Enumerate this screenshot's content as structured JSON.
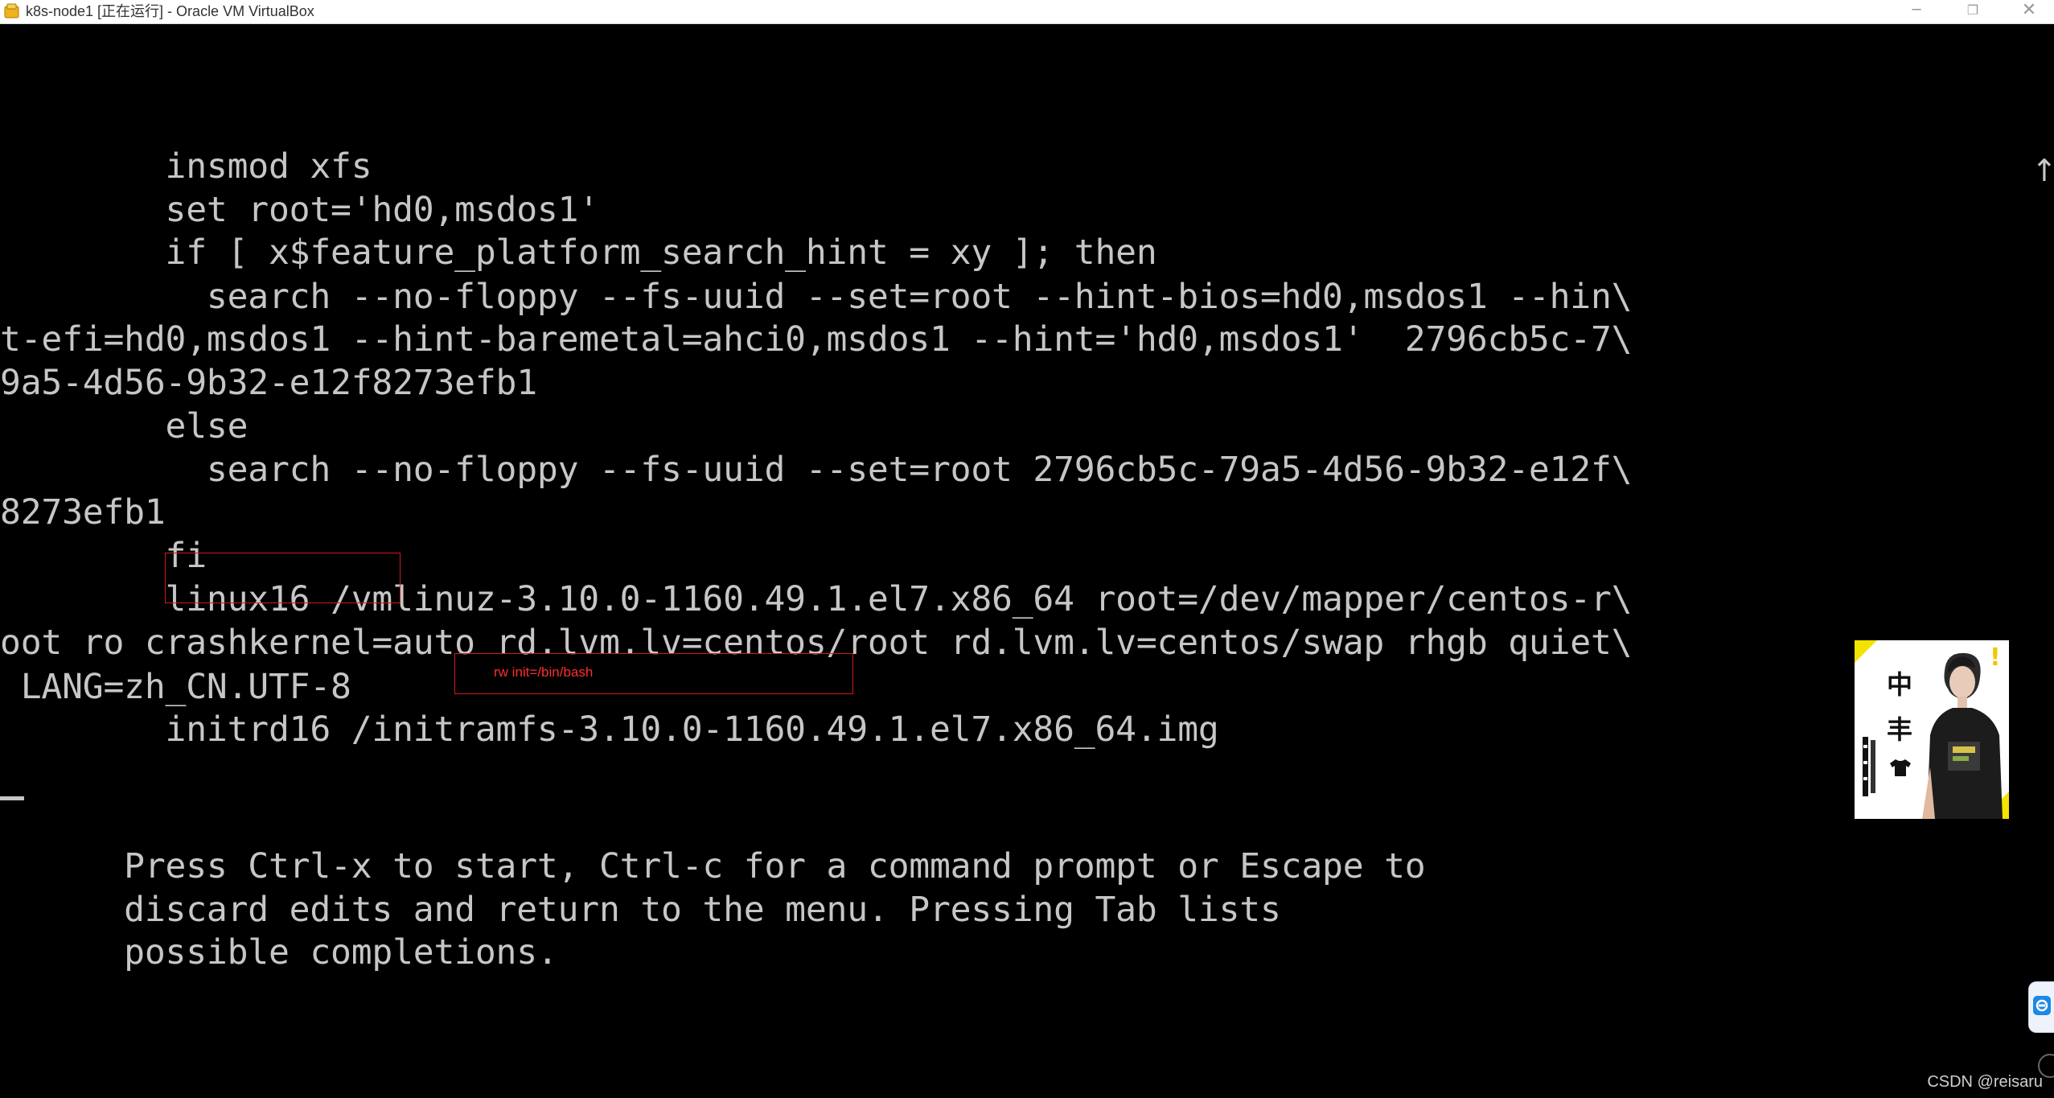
{
  "window": {
    "title": "k8s-node1 [正在运行] - Oracle VM VirtualBox",
    "icon": "virtualbox-icon",
    "controls": {
      "minimize": "─",
      "restore": "❐",
      "close": "✕"
    }
  },
  "console": {
    "lines": [
      "        insmod xfs",
      "        set root='hd0,msdos1'",
      "        if [ x$feature_platform_search_hint = xy ]; then",
      "          search --no-floppy --fs-uuid --set=root --hint-bios=hd0,msdos1 --hin\\",
      "t-efi=hd0,msdos1 --hint-baremetal=ahci0,msdos1 --hint='hd0,msdos1'  2796cb5c-7\\",
      "9a5-4d56-9b32-e12f8273efb1",
      "        else",
      "          search --no-floppy --fs-uuid --set=root 2796cb5c-79a5-4d56-9b32-e12f\\",
      "8273efb1",
      "        fi",
      "        linux16 /vmlinuz-3.10.0-1160.49.1.el7.x86_64 root=/dev/mapper/centos-r\\",
      "oot ro crashkernel=auto rd.lvm.lv=centos/root rd.lvm.lv=centos/swap rhgb quiet\\",
      " LANG=zh_CN.UTF-8",
      "        initrd16 /initramfs-3.10.0-1160.49.1.el7.x86_64.img"
    ],
    "help": [
      "      Press Ctrl-x to start, Ctrl-c for a command prompt or Escape to",
      "      discard edits and return to the menu. Pressing Tab lists",
      "      possible completions."
    ],
    "scroll_indicator": "↑",
    "text_color": "#c6c6c6",
    "background": "#000000"
  },
  "annotations": {
    "note": "rw init=/bin/bash",
    "color": "#d11a1a"
  },
  "overlay": {
    "poster_chars": [
      "中",
      "丰"
    ],
    "mark": "!"
  },
  "watermark": "CSDN @reisaru"
}
